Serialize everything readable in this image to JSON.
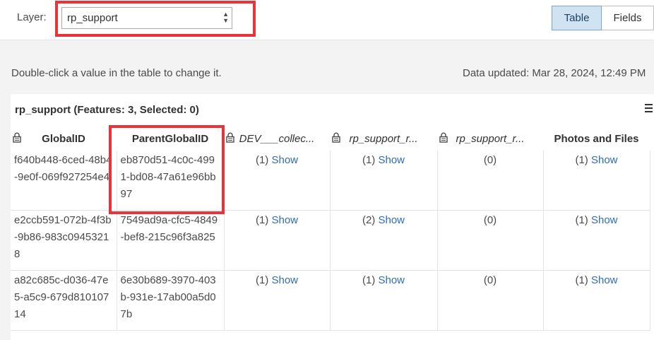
{
  "toolbar": {
    "layer_label": "Layer:",
    "layer_value": "rp_support",
    "table_button": "Table",
    "fields_button": "Fields"
  },
  "info": {
    "hint": "Double-click a value in the table to change it.",
    "updated": "Data updated: Mar 28, 2024, 12:49 PM"
  },
  "panel": {
    "title": "rp_support (Features: 3, Selected: 0)"
  },
  "columns": [
    {
      "label": "GlobalID",
      "locked": true
    },
    {
      "label": "ParentGlobalID",
      "locked": false
    },
    {
      "label": "DEV___collec...",
      "locked": true
    },
    {
      "label": "rp_support_r...",
      "locked": true
    },
    {
      "label": "rp_support_r...",
      "locked": true
    },
    {
      "label": "Photos and Files",
      "locked": false
    }
  ],
  "rows": [
    {
      "globalid": "f640b448-6ced-48b4-9e0f-069f927254e4",
      "parentglobalid": "eb870d51-4c0c-4991-bd08-47a61e96bb97",
      "c3_count": "(1)",
      "c3_link": "Show",
      "c4_count": "(1)",
      "c4_link": "Show",
      "c5_count": "(0)",
      "c6_count": "(1)",
      "c6_link": "Show"
    },
    {
      "globalid": "e2ccb591-072b-4f3b-9b86-983c09453218",
      "parentglobalid": "7549ad9a-cfc5-4849-bef8-215c96f3a825",
      "c3_count": "(1)",
      "c3_link": "Show",
      "c4_count": "(2)",
      "c4_link": "Show",
      "c5_count": "(0)",
      "c6_count": "(1)",
      "c6_link": "Show"
    },
    {
      "globalid": "a82c685c-d036-47e5-a5c9-679d81010714",
      "parentglobalid": "6e30b689-3970-403b-931e-17ab00a5d07b",
      "c3_count": "(1)",
      "c3_link": "Show",
      "c4_count": "(1)",
      "c4_link": "Show",
      "c5_count": "(0)",
      "c6_count": "(1)",
      "c6_link": "Show"
    }
  ],
  "colors": {
    "highlight": "#e8333a",
    "link": "#2f6db5",
    "active_toggle": "#cfe3f3"
  },
  "icons": [
    "lock-icon",
    "menu-icon",
    "select-arrows-icon"
  ]
}
